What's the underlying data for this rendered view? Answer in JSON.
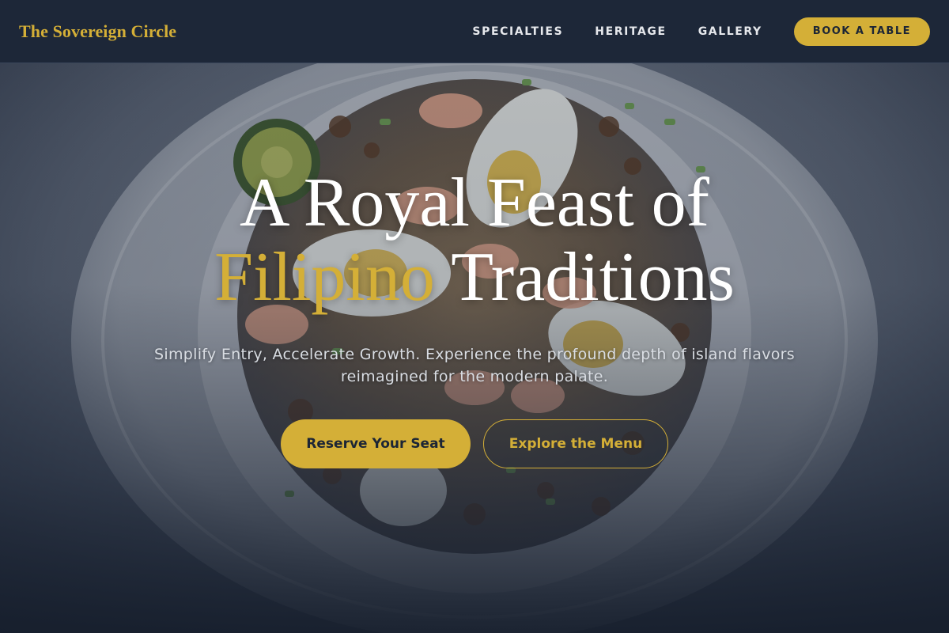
{
  "brand": {
    "name": "The Sovereign Circle"
  },
  "nav": {
    "links": [
      "SPECIALTIES",
      "HERITAGE",
      "GALLERY"
    ],
    "cta_label": "BOOK A TABLE"
  },
  "hero": {
    "title_line1": "A Royal Feast of",
    "title_accent": "Filipino",
    "title_rest": "Traditions",
    "subtitle": "Simplify Entry, Accelerate Growth. Experience the profound depth of island flavors reimagined for the modern palate.",
    "primary_cta": "Reserve Your Seat",
    "secondary_cta": "Explore the Menu",
    "background_image": "plated-pancit-noodle-dish"
  },
  "colors": {
    "accent_gold": "#d4af37",
    "navy": "#1c2535",
    "text_light": "#ffffff"
  }
}
